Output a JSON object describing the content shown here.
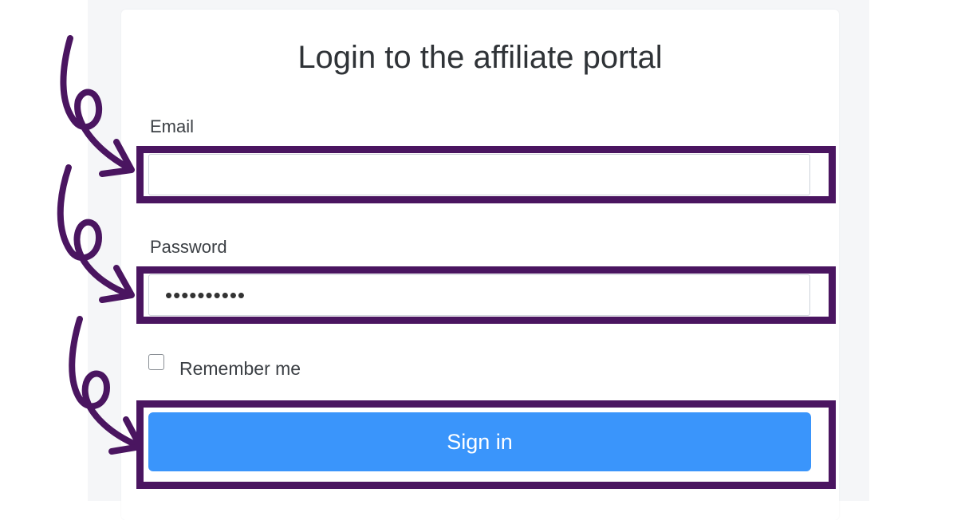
{
  "form": {
    "title": "Login to the affiliate portal",
    "email_label": "Email",
    "email_value": "",
    "password_label": "Password",
    "password_value": "••••••••••",
    "remember_label": "Remember me",
    "remember_checked": false,
    "submit_label": "Sign in"
  },
  "colors": {
    "accent": "#3a95fb",
    "highlight": "#4a1560",
    "page_background": "#f5f6f8"
  },
  "annotations": {
    "highlighted_elements": [
      "email-field",
      "password-field",
      "sign-in-button"
    ],
    "arrow_icon": "curly-arrow-icon"
  }
}
